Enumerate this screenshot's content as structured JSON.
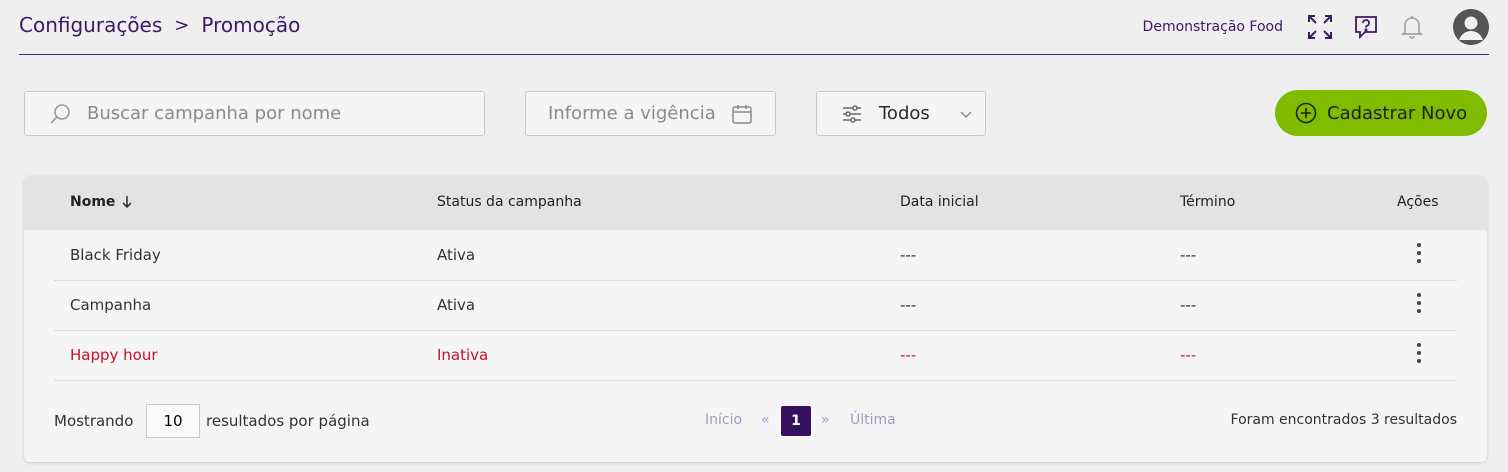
{
  "header": {
    "breadcrumb": [
      "Configurações",
      "Promoção"
    ],
    "breadcrumb_sep": ">",
    "company": "Demonstração Food",
    "icons": [
      "expand-icon",
      "help-chat-icon",
      "bell-icon",
      "user-avatar-icon"
    ]
  },
  "filters": {
    "search_placeholder": "Buscar campanha por nome",
    "date_placeholder": "Informe a vigência",
    "status_value": "Todos",
    "add_label": "Cadastrar Novo"
  },
  "table": {
    "columns": [
      "Nome",
      "Status da campanha",
      "Data inicial",
      "Término",
      "Ações"
    ],
    "rows": [
      {
        "name": "Black Friday",
        "status": "Ativa",
        "start": "---",
        "end": "---"
      },
      {
        "name": "Campanha",
        "status": "Ativa",
        "start": "---",
        "end": "---"
      },
      {
        "name": "Happy hour",
        "status": "Inativa",
        "start": "---",
        "end": "---"
      }
    ]
  },
  "footer": {
    "showing": "Mostrando",
    "per_page_value": "10",
    "per_page_label": "resultados por página",
    "first": "Início",
    "prev": "«",
    "current_page": "1",
    "next": "»",
    "last": "Última",
    "found": "Foram encontrados 3 resultados"
  },
  "colors": {
    "brand": "#3d1a66",
    "accent": "#7fbc00",
    "inactive": "#c8102e",
    "page_active": "#34105f"
  }
}
